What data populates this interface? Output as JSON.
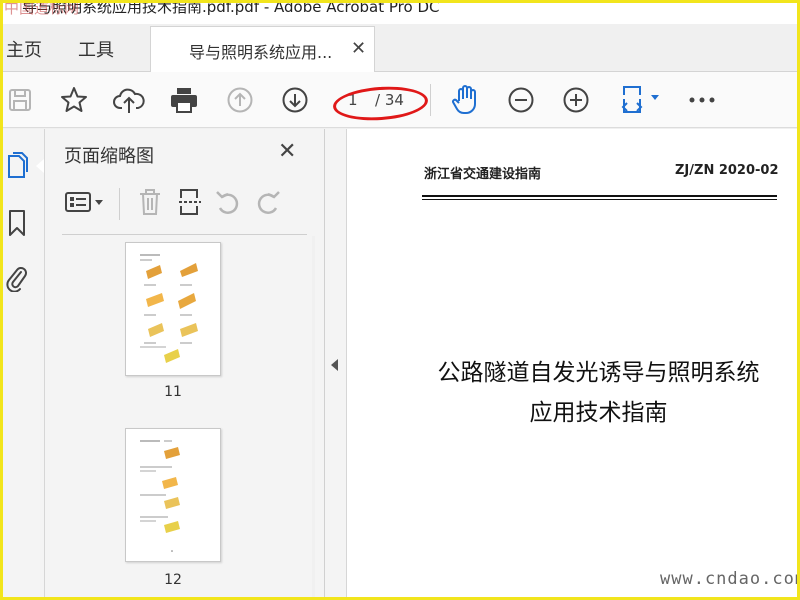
{
  "titlebar": {
    "title": "导与照明系统应用技术指南.pdf.pdf - Adobe Acrobat Pro DC",
    "watermark_text": "中国道标网"
  },
  "nav": {
    "home": "主页",
    "tools": "工具",
    "doc_tab": "导与照明系统应用...",
    "close_glyph": "✕"
  },
  "toolbar": {
    "current_page": "1",
    "total_pages": "/ 34",
    "accent_color": "#1f6fd1",
    "annotation_color": "#e01818"
  },
  "panel": {
    "title": "页面缩略图",
    "close_glyph": "✕",
    "thumbnails": [
      {
        "page": "11"
      },
      {
        "page": "12"
      }
    ]
  },
  "document": {
    "header_left": "浙江省交通建设指南",
    "header_right": "ZJ/ZN 2020-02",
    "title_line1": "公路隧道自发光诱导与照明系统",
    "title_line2": "应用技术指南"
  },
  "site_watermark": "www.cndao.com",
  "frame_color": "#f2e51c"
}
